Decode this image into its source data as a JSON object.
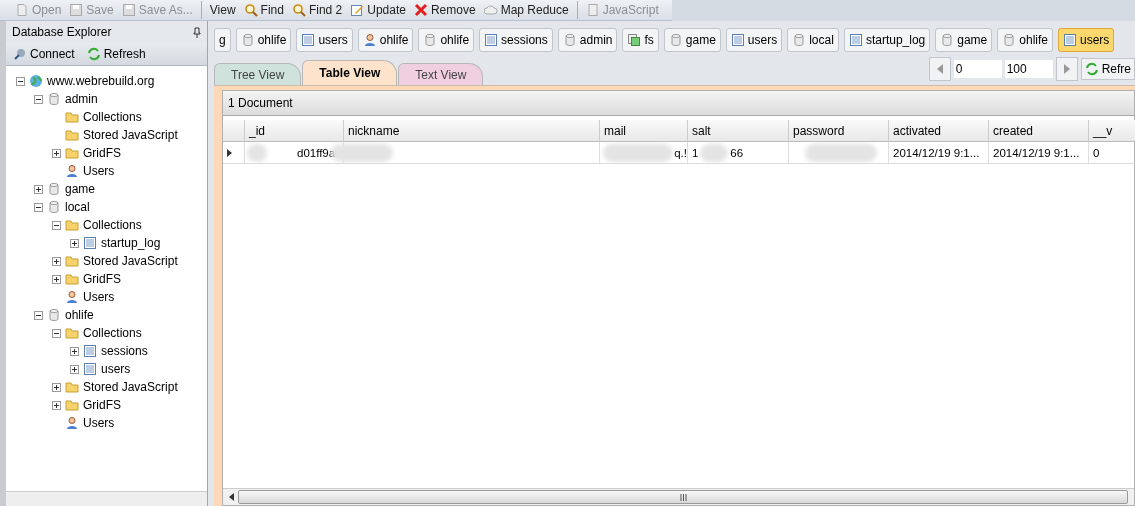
{
  "toolbar": [
    {
      "label": "Open",
      "kind": "open",
      "disabled": true
    },
    {
      "label": "Save",
      "kind": "save",
      "disabled": true
    },
    {
      "label": "Save As...",
      "kind": "save",
      "disabled": true
    },
    {
      "label": "View",
      "kind": "plain",
      "disabled": false
    },
    {
      "label": "Find",
      "kind": "find",
      "disabled": false
    },
    {
      "label": "Find 2",
      "kind": "find",
      "disabled": false
    },
    {
      "label": "Update",
      "kind": "update",
      "disabled": false
    },
    {
      "label": "Remove",
      "kind": "remove",
      "disabled": false
    },
    {
      "label": "Map Reduce",
      "kind": "cloud",
      "disabled": false
    },
    {
      "label": "JavaScript",
      "kind": "script",
      "disabled": true
    }
  ],
  "explorer": {
    "title": "Database Explorer",
    "buttons": [
      {
        "label": "Connect",
        "kind": "connect"
      },
      {
        "label": "Refresh",
        "kind": "refresh"
      }
    ],
    "tree": [
      {
        "label": "www.webrebuild.org",
        "kind": "server",
        "expanded": true,
        "children": [
          {
            "label": "admin",
            "kind": "db",
            "expanded": true,
            "children": [
              {
                "label": "Collections",
                "kind": "folder"
              },
              {
                "label": "Stored JavaScript",
                "kind": "folder"
              },
              {
                "label": "GridFS",
                "kind": "folder",
                "expanded": false
              },
              {
                "label": "Users",
                "kind": "user"
              }
            ]
          },
          {
            "label": "game",
            "kind": "db",
            "expanded": false
          },
          {
            "label": "local",
            "kind": "db",
            "expanded": true,
            "children": [
              {
                "label": "Collections",
                "kind": "folder",
                "expanded": true,
                "children": [
                  {
                    "label": "startup_log",
                    "kind": "collection",
                    "expanded": false
                  }
                ]
              },
              {
                "label": "Stored JavaScript",
                "kind": "folder",
                "expanded": false
              },
              {
                "label": "GridFS",
                "kind": "folder",
                "expanded": false
              },
              {
                "label": "Users",
                "kind": "user"
              }
            ]
          },
          {
            "label": "ohlife",
            "kind": "db",
            "expanded": true,
            "children": [
              {
                "label": "Collections",
                "kind": "folder",
                "expanded": true,
                "children": [
                  {
                    "label": "sessions",
                    "kind": "collection",
                    "expanded": false
                  },
                  {
                    "label": "users",
                    "kind": "collection",
                    "expanded": false
                  }
                ]
              },
              {
                "label": "Stored JavaScript",
                "kind": "folder",
                "expanded": false
              },
              {
                "label": "GridFS",
                "kind": "folder",
                "expanded": false
              },
              {
                "label": "Users",
                "kind": "user"
              }
            ]
          }
        ]
      }
    ]
  },
  "doc_tabs": [
    {
      "label": "g",
      "kind": "plain",
      "selected": false
    },
    {
      "label": "ohlife",
      "kind": "db",
      "selected": false
    },
    {
      "label": "users",
      "kind": "collection",
      "selected": false
    },
    {
      "label": "ohlife",
      "kind": "user",
      "selected": false
    },
    {
      "label": "ohlife",
      "kind": "db",
      "selected": false
    },
    {
      "label": "sessions",
      "kind": "collection",
      "selected": false
    },
    {
      "label": "admin",
      "kind": "db",
      "selected": false
    },
    {
      "label": "fs",
      "kind": "fs",
      "selected": false
    },
    {
      "label": "game",
      "kind": "db",
      "selected": false
    },
    {
      "label": "users",
      "kind": "collection",
      "selected": false
    },
    {
      "label": "local",
      "kind": "db",
      "selected": false
    },
    {
      "label": "startup_log",
      "kind": "collection",
      "selected": false
    },
    {
      "label": "game",
      "kind": "db",
      "selected": false
    },
    {
      "label": "ohlife",
      "kind": "db",
      "selected": false
    },
    {
      "label": "users",
      "kind": "collection",
      "selected": true
    }
  ],
  "view_tabs": [
    {
      "label": "Tree View",
      "selected": false,
      "color": "#cfe3dc"
    },
    {
      "label": "Table View",
      "selected": true,
      "color": "#fde3cc"
    },
    {
      "label": "Text View",
      "selected": false,
      "color": "#f0d0e0"
    }
  ],
  "pager": {
    "skip": "0",
    "limit": "100",
    "refresh": "Refre"
  },
  "result": {
    "count": "1 Document",
    "columns": [
      "_id",
      "nickname",
      "mail",
      "salt",
      "password",
      "activated",
      "created",
      "__v"
    ],
    "rows": [
      {
        "cells": [
          "d01ff9a",
          "",
          "q.!",
          "1          66",
          "",
          "2014/12/19 9:1...",
          "2014/12/19 9:1...",
          "0"
        ]
      }
    ]
  }
}
